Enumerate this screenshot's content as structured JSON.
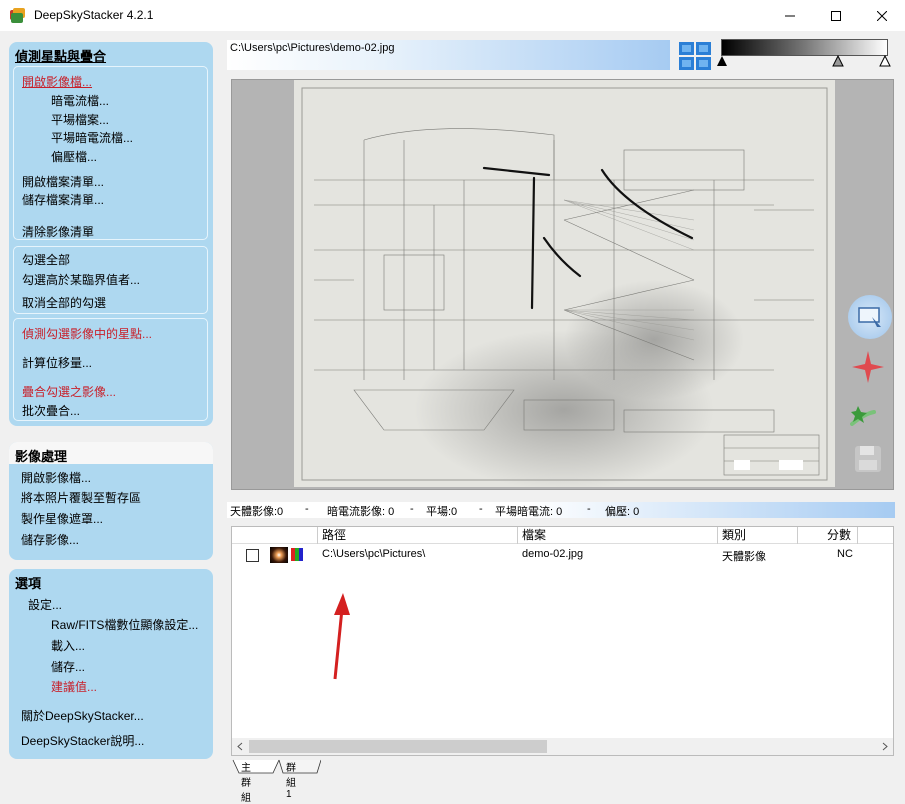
{
  "window": {
    "title": "DeepSkyStacker 4.2.1"
  },
  "register": {
    "heading": "偵測星點與疊合",
    "open_images": "開啟影像檔...",
    "dark_files": "暗電流檔...",
    "flat_files": "平場檔案...",
    "dark_flat_files": "平場暗電流檔...",
    "offset_files": "偏壓檔...",
    "open_file_list": "開啟檔案清單...",
    "save_file_list": "儲存檔案清單...",
    "clear_list": "清除影像清單",
    "check_all": "勾選全部",
    "check_above": "勾選高於某臨界值者...",
    "uncheck_all": "取消全部的勾選",
    "register_checked": "偵測勾選影像中的星點...",
    "compute_offsets": "計算位移量...",
    "stack_checked": "疊合勾選之影像...",
    "batch_stacking": "批次疊合..."
  },
  "processing": {
    "heading": "影像處理",
    "open_image": "開啟影像檔...",
    "copy_to_clipboard": "將本照片覆製至暫存區",
    "create_starmask": "製作星像遮罩...",
    "save_image": "儲存影像..."
  },
  "options": {
    "heading": "選項",
    "settings": "設定...",
    "raw_fits": "Raw/FITS檔數位顯像設定...",
    "load": "載入...",
    "save": "儲存...",
    "recommended": "建議值...",
    "about": "關於DeepSkyStacker...",
    "help": "DeepSkyStacker說明..."
  },
  "viewer": {
    "path": "C:\\Users\\pc\\Pictures\\demo-02.jpg"
  },
  "status": {
    "light": "天體影像:0",
    "dark": "暗電流影像: 0",
    "flat": "平場:0",
    "dark_flat": "平場暗電流: 0",
    "offset": "偏壓: 0",
    "sep": "-"
  },
  "table": {
    "headers": [
      "路徑",
      "檔案",
      "類別",
      "分數"
    ],
    "rows": [
      {
        "path": "C:\\Users\\pc\\Pictures\\",
        "file": "demo-02.jpg",
        "type": "天體影像",
        "score": "NC"
      }
    ]
  },
  "tabs": [
    "主群組",
    "群組 1"
  ],
  "colors": {
    "panel": "#aed8f0",
    "accent_red": "#c8202a",
    "path_grad_end": "#a6cbf2"
  }
}
